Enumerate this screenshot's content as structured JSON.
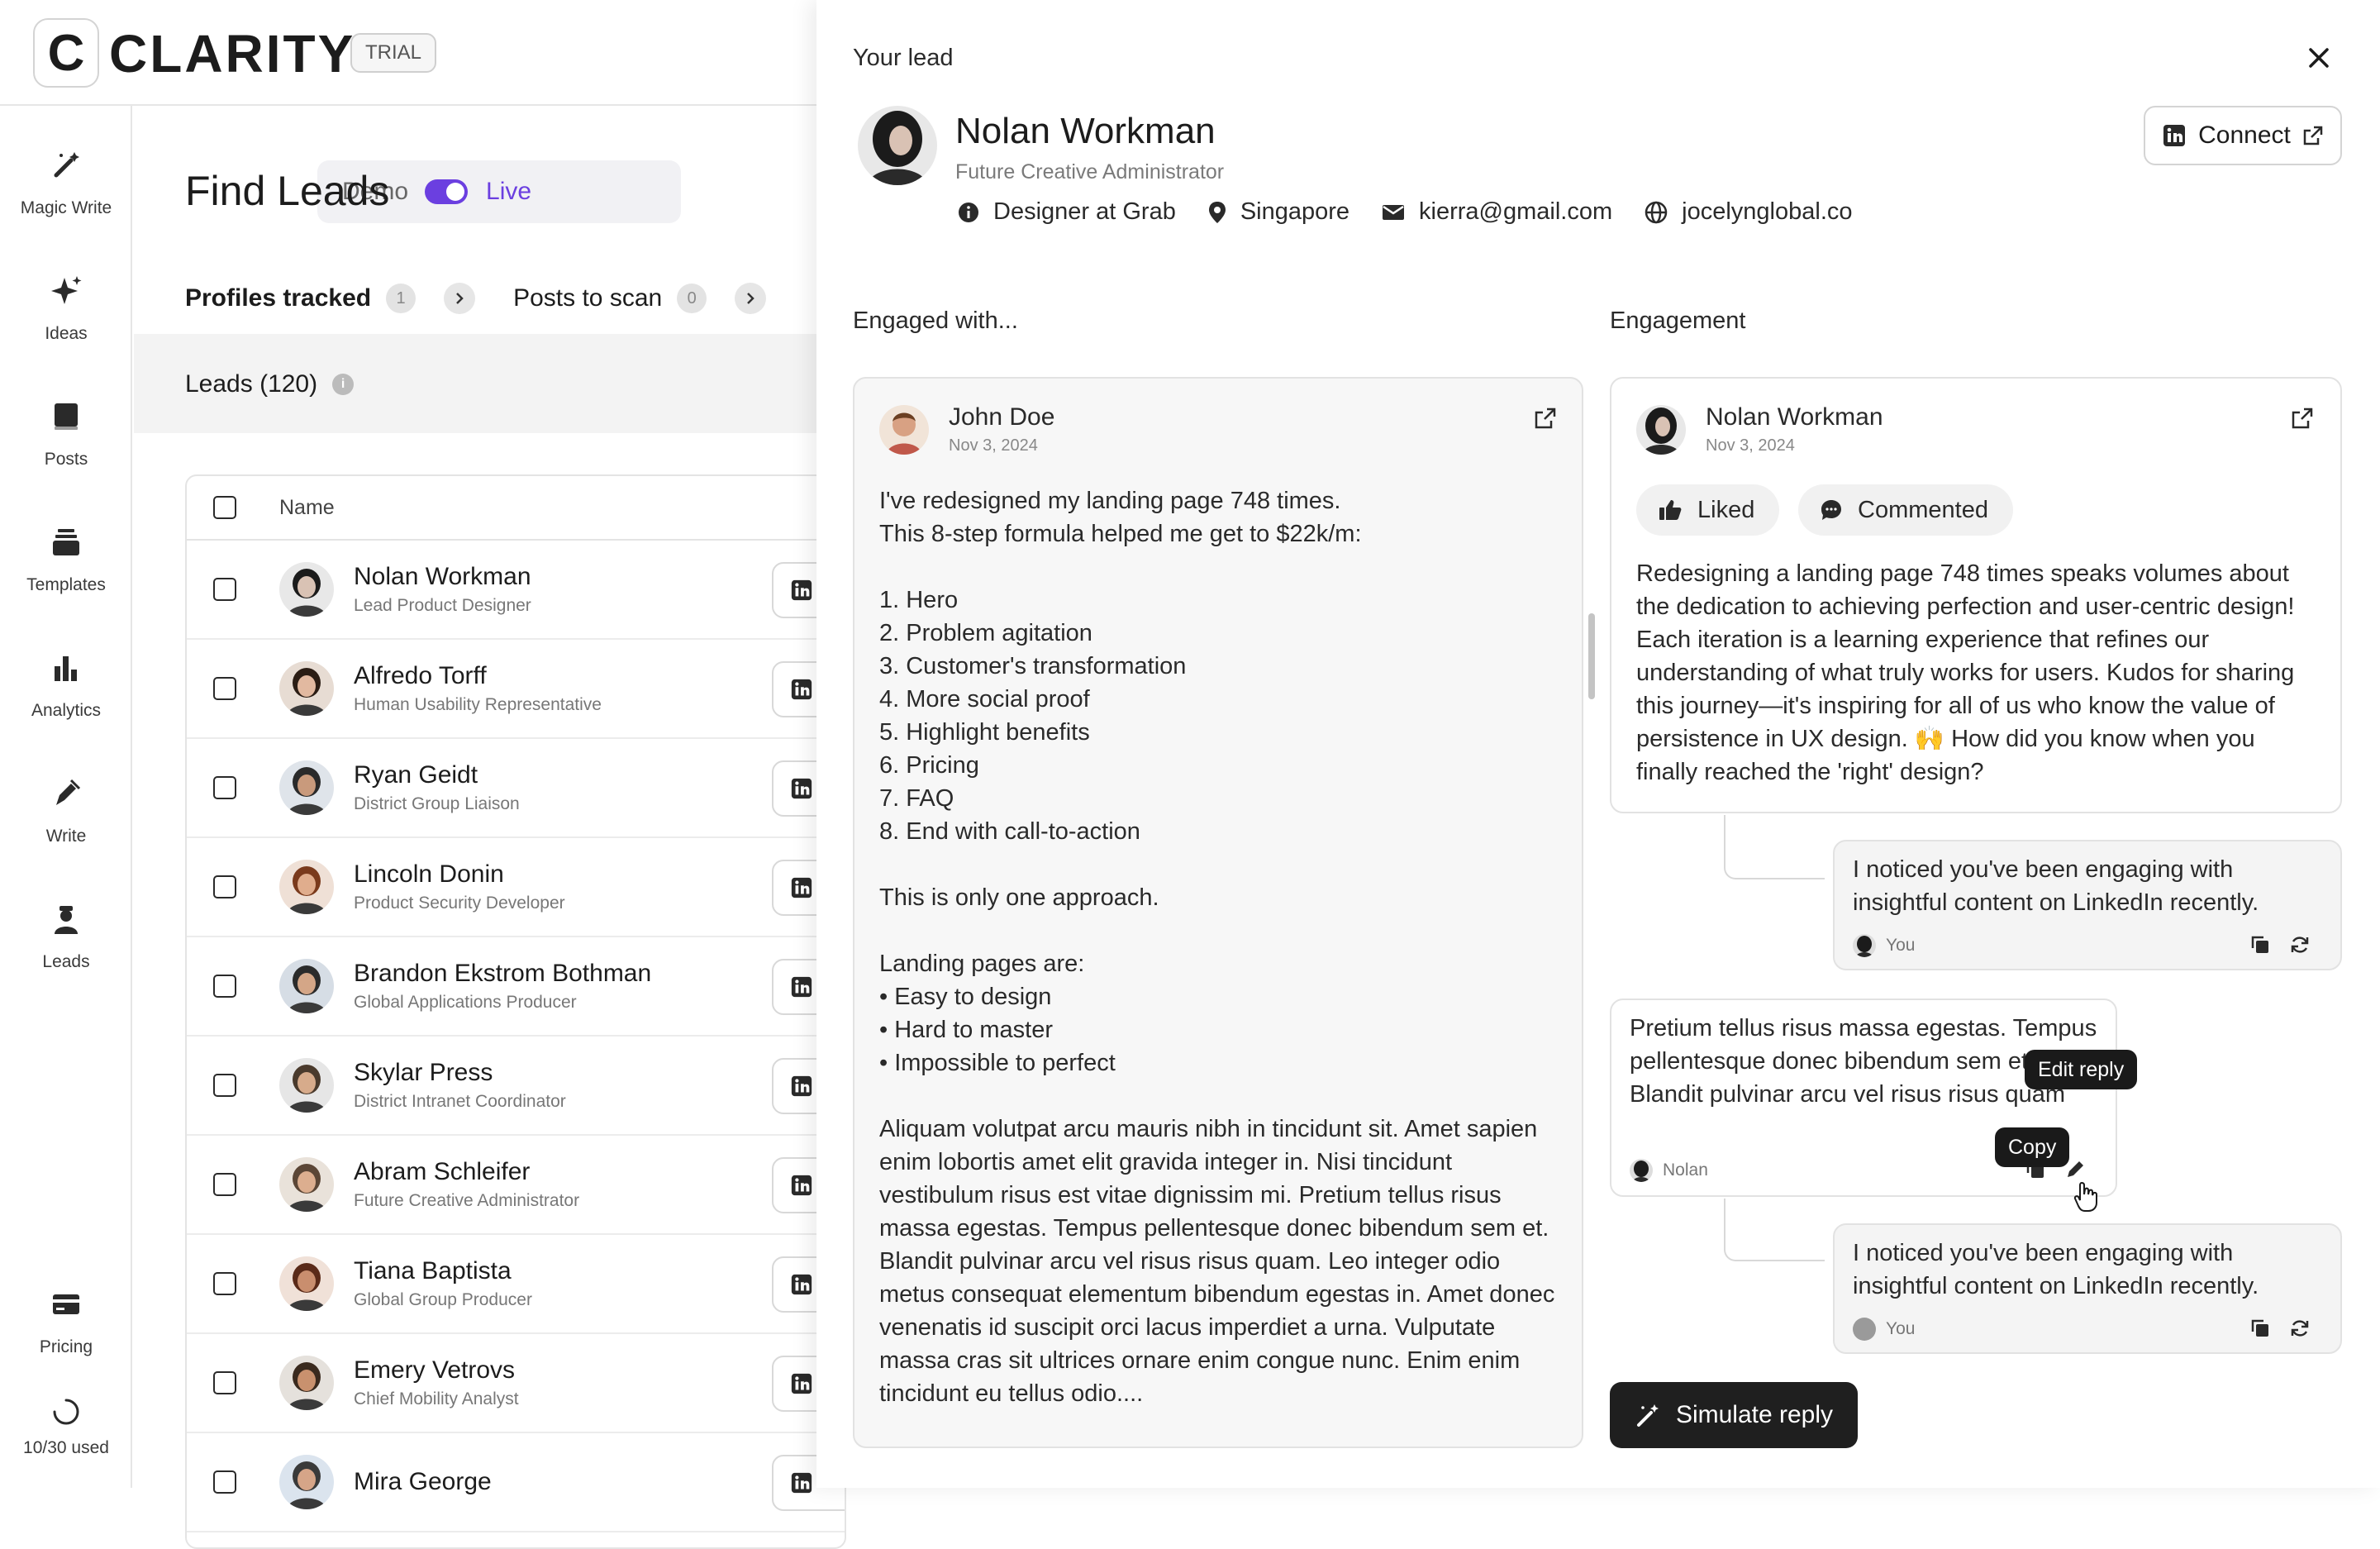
{
  "brand": {
    "logo_letter": "C",
    "name": "CLARITY",
    "badge": "TRIAL"
  },
  "nav": {
    "items": [
      {
        "label": "Magic Write",
        "icon": "magic-wand-icon"
      },
      {
        "label": "Ideas",
        "icon": "sparkles-icon"
      },
      {
        "label": "Posts",
        "icon": "book-icon"
      },
      {
        "label": "Templates",
        "icon": "stack-icon"
      },
      {
        "label": "Analytics",
        "icon": "bar-chart-icon"
      },
      {
        "label": "Write",
        "icon": "pen-icon"
      },
      {
        "label": "Leads",
        "icon": "person-icon"
      },
      {
        "label": "Pricing",
        "icon": "credit-card-icon"
      }
    ],
    "usage": "10/30 used"
  },
  "main": {
    "title": "Find Leads",
    "mode_toggle": {
      "off_label": "Demo",
      "on_label": "Live",
      "on": true
    },
    "tabs": [
      {
        "label": "Profiles tracked",
        "count": "1"
      },
      {
        "label": "Posts to scan",
        "count": "0"
      }
    ],
    "leads_label": "Leads (120)",
    "table": {
      "name_header": "Name",
      "rows": [
        {
          "name": "Nolan Workman",
          "role": "Lead Product Designer"
        },
        {
          "name": "Alfredo Torff",
          "role": "Human Usability Representative"
        },
        {
          "name": "Ryan Geidt",
          "role": "District Group Liaison"
        },
        {
          "name": "Lincoln Donin",
          "role": "Product Security Developer"
        },
        {
          "name": "Brandon Ekstrom Bothman",
          "role": "Global Applications Producer"
        },
        {
          "name": "Skylar Press",
          "role": "District Intranet Coordinator"
        },
        {
          "name": "Abram Schleifer",
          "role": "Future Creative Administrator"
        },
        {
          "name": "Tiana Baptista",
          "role": "Global Group Producer"
        },
        {
          "name": "Emery Vetrovs",
          "role": "Chief Mobility Analyst"
        },
        {
          "name": "Mira George",
          "role": ""
        }
      ]
    }
  },
  "panel": {
    "title": "Your lead",
    "lead": {
      "name": "Nolan Workman",
      "role": "Future Creative Administrator",
      "job": "Designer at Grab",
      "location": "Singapore",
      "email": "kierra@gmail.com",
      "website": "jocelynglobal.co"
    },
    "connect_label": "Connect",
    "engaged_with_heading": "Engaged with...",
    "engagement_heading": "Engagement",
    "post": {
      "author": "John Doe",
      "date": "Nov 3, 2024",
      "body": "I've redesigned my landing page 748 times.\nThis 8-step formula helped me get to $22k/m:\n\n1. Hero\n2. Problem agitation\n3. Customer's transformation\n4. More social proof\n5. Highlight benefits\n6. Pricing\n7. FAQ\n8. End with call-to-action\n\nThis is only one approach.\n\nLanding pages are:\n• Easy to design\n• Hard to master\n• Impossible to perfect\n\nAliquam volutpat arcu mauris nibh in tincidunt sit. Amet sapien enim lobortis amet elit gravida integer in. Nisi tincidunt vestibulum risus est vitae dignissim mi. Pretium tellus risus massa egestas. Tempus pellentesque donec bibendum sem et. Blandit pulvinar arcu vel risus risus quam. Leo integer odio metus consequat elementum bibendum egestas in. Amet donec venenatis id suscipit orci lacus imperdiet a urna. Vulputate massa cras sit ultrices ornare enim congue nunc. Enim enim tincidunt eu tellus odio...."
    },
    "engagement": {
      "author": "Nolan Workman",
      "date": "Nov 3, 2024",
      "chips": [
        "Liked",
        "Commented"
      ],
      "comment": "Redesigning a landing page 748 times speaks volumes about the dedication to achieving perfection and user-centric design! Each iteration is a learning experience that refines our understanding of what truly works for users. Kudos for sharing this journey—it's inspiring for all of us who know the value of persistence in UX design. 🙌 How did you know when you finally reached the 'right' design?"
    },
    "replies": [
      {
        "text": "I noticed you've been engaging with insightful content on LinkedIn recently.",
        "author": "You"
      },
      {
        "text": "Pretium tellus risus massa egestas. Tempus pellentesque donec bibendum sem et. Blandit pulvinar arcu vel risus risus quam",
        "author": "Nolan"
      },
      {
        "text": "I noticed you've been engaging with insightful content on LinkedIn recently.",
        "author": "You"
      }
    ],
    "tooltips": {
      "edit": "Edit reply",
      "copy": "Copy"
    },
    "simulate_label": "Simulate reply"
  },
  "colors": {
    "accent": "#6b3fe0",
    "dark_button": "#1f1f1f"
  }
}
